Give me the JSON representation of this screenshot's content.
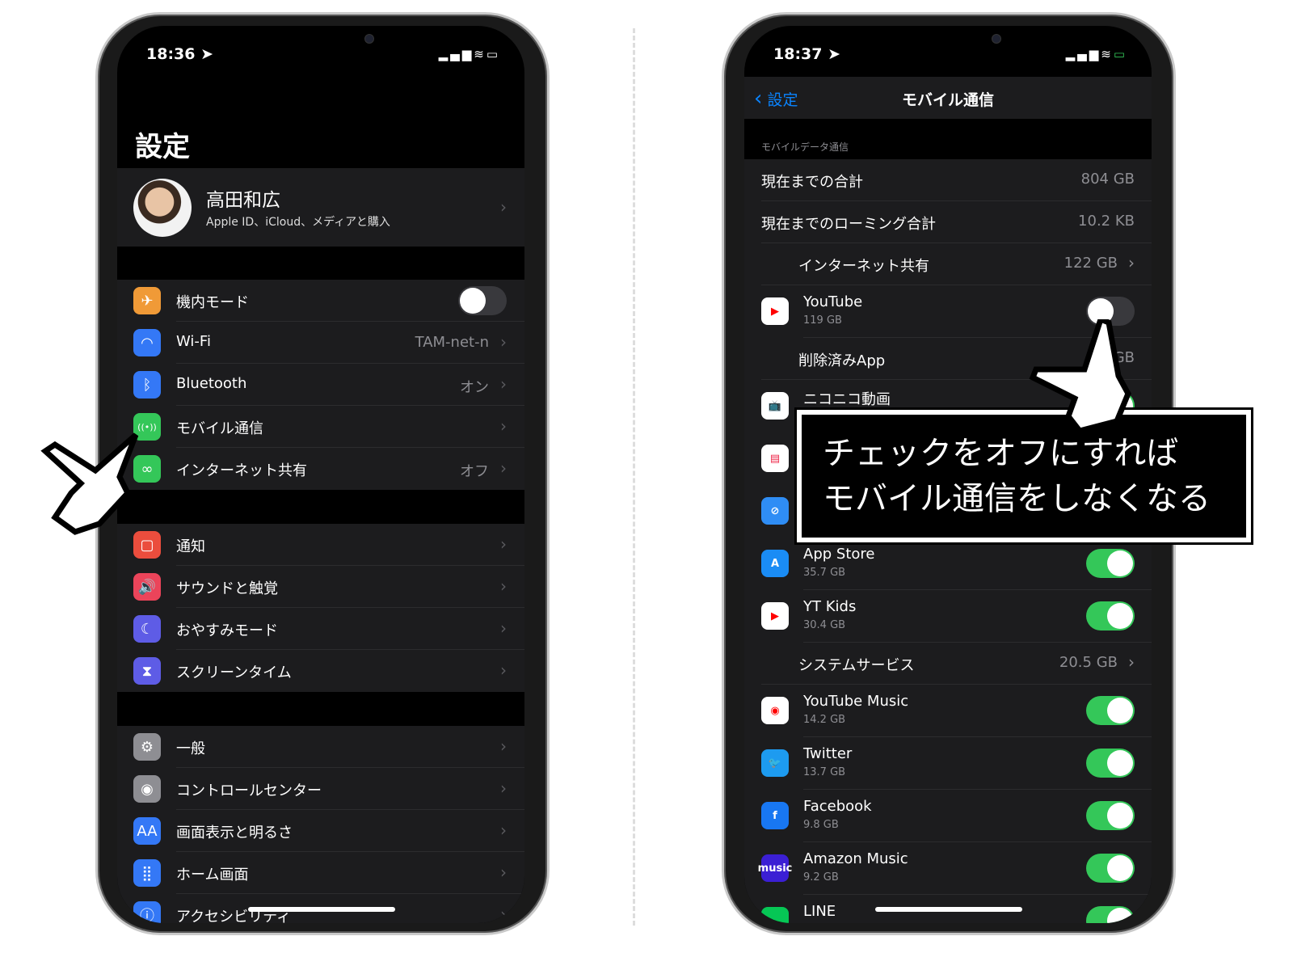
{
  "left_phone": {
    "time": "18:36",
    "title": "設定",
    "profile": {
      "name": "高田和広",
      "subtitle": "Apple ID、iCloud、メディアと購入"
    },
    "groups": [
      [
        {
          "label": "機内モード",
          "icon": "airplane-icon",
          "glyph": "✈",
          "color": "#f09a37",
          "toggle": false
        },
        {
          "label": "Wi-Fi",
          "icon": "wifi-icon",
          "glyph": "◠",
          "color": "#3478f6",
          "value": "TAM-net-n"
        },
        {
          "label": "Bluetooth",
          "icon": "bluetooth-icon",
          "glyph": "ᛒ",
          "color": "#3478f6",
          "value": "オン"
        },
        {
          "label": "モバイル通信",
          "icon": "antenna-icon",
          "glyph": "((•))",
          "color": "#34c759"
        },
        {
          "label": "インターネット共有",
          "icon": "link-icon",
          "glyph": "∞",
          "color": "#34c759",
          "value": "オフ"
        }
      ],
      [
        {
          "label": "通知",
          "icon": "notification-icon",
          "glyph": "▢",
          "color": "#eb4d3d"
        },
        {
          "label": "サウンドと触覚",
          "icon": "speaker-icon",
          "glyph": "🔊",
          "color": "#eb445a"
        },
        {
          "label": "おやすみモード",
          "icon": "moon-icon",
          "glyph": "☾",
          "color": "#5e5ce6"
        },
        {
          "label": "スクリーンタイム",
          "icon": "hourglass-icon",
          "glyph": "⧗",
          "color": "#5e5ce6"
        }
      ],
      [
        {
          "label": "一般",
          "icon": "gear-icon",
          "glyph": "⚙",
          "color": "#8e8e93"
        },
        {
          "label": "コントロールセンター",
          "icon": "switches-icon",
          "glyph": "◉",
          "color": "#8e8e93"
        },
        {
          "label": "画面表示と明るさ",
          "icon": "text-size-icon",
          "glyph": "AA",
          "color": "#3478f6"
        },
        {
          "label": "ホーム画面",
          "icon": "grid-icon",
          "glyph": "⣿",
          "color": "#3478f6"
        },
        {
          "label": "アクセシビリティ",
          "icon": "accessibility-icon",
          "glyph": "ⓘ",
          "color": "#3478f6"
        }
      ]
    ]
  },
  "right_phone": {
    "time": "18:37",
    "back_label": "設定",
    "title": "モバイル通信",
    "section_label": "モバイルデータ通信",
    "rows": [
      {
        "kind": "value",
        "label": "現在までの合計",
        "value": "804 GB"
      },
      {
        "kind": "value",
        "label": "現在までのローミング合計",
        "value": "10.2 KB"
      },
      {
        "kind": "link",
        "label": "インターネット共有",
        "value": "122 GB"
      },
      {
        "kind": "app",
        "label": "YouTube",
        "sub": "119 GB",
        "icon": "youtube-icon",
        "color": "#ffffff",
        "glyph": "▶",
        "glyph_color": "#ff0000",
        "toggle": false
      },
      {
        "kind": "value-indent",
        "label": "削除済みApp",
        "value": "GB"
      },
      {
        "kind": "app",
        "label": "ニコニコ動画",
        "sub": "",
        "icon": "niconico-icon",
        "color": "#ffffff",
        "glyph": "📺",
        "glyph_color": "#333333",
        "toggle": true
      },
      {
        "kind": "app",
        "label": "",
        "sub": "",
        "icon": "news-app-icon",
        "color": "#ffffff",
        "glyph": "▤",
        "glyph_color": "#e24",
        "toggle": true
      },
      {
        "kind": "app",
        "label": "",
        "sub": "",
        "icon": "safari-icon",
        "color": "#2f8df5",
        "glyph": "⊘",
        "glyph_color": "#ffffff",
        "toggle": true
      },
      {
        "kind": "app",
        "label": "App Store",
        "sub": "35.7 GB",
        "icon": "app-store-icon",
        "color": "#1a8cf5",
        "glyph": "A",
        "glyph_color": "#ffffff",
        "toggle": true
      },
      {
        "kind": "app",
        "label": "YT Kids",
        "sub": "30.4 GB",
        "icon": "yt-kids-icon",
        "color": "#ffffff",
        "glyph": "▶",
        "glyph_color": "#ff0000",
        "toggle": true
      },
      {
        "kind": "link",
        "label": "システムサービス",
        "value": "20.5 GB"
      },
      {
        "kind": "app",
        "label": "YouTube Music",
        "sub": "14.2 GB",
        "icon": "youtube-music-icon",
        "color": "#ffffff",
        "glyph": "◉",
        "glyph_color": "#ff0000",
        "toggle": true
      },
      {
        "kind": "app",
        "label": "Twitter",
        "sub": "13.7 GB",
        "icon": "twitter-icon",
        "color": "#1d9bf0",
        "glyph": "🐦",
        "glyph_color": "#ffffff",
        "toggle": true
      },
      {
        "kind": "app",
        "label": "Facebook",
        "sub": "9.8 GB",
        "icon": "facebook-icon",
        "color": "#1877f2",
        "glyph": "f",
        "glyph_color": "#ffffff",
        "toggle": true
      },
      {
        "kind": "app",
        "label": "Amazon Music",
        "sub": "9.2 GB",
        "icon": "amazon-music-icon",
        "color": "#3b1fd4",
        "glyph": "music",
        "glyph_color": "#ffffff",
        "toggle": true
      },
      {
        "kind": "app",
        "label": "LINE",
        "sub": "",
        "icon": "line-icon",
        "color": "#06c755",
        "glyph": "",
        "glyph_color": "#ffffff",
        "toggle": true
      }
    ]
  },
  "callout": {
    "line1": "チェックをオフにすれば",
    "line2": "モバイル通信をしなくなる"
  },
  "colors": {
    "toggle_on": "#34c759",
    "accent": "#0a84ff",
    "row_bg": "#1c1c1e"
  }
}
